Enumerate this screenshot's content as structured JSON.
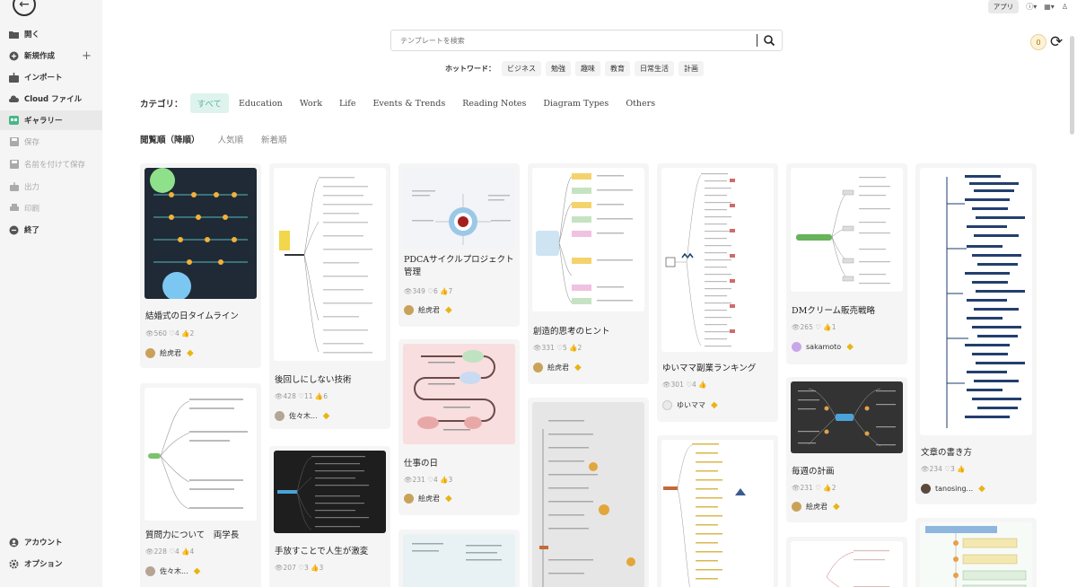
{
  "sidebar": {
    "items": [
      {
        "label": "開く",
        "icon": "folder-icon",
        "state": "normal"
      },
      {
        "label": "新規作成",
        "icon": "plus-circle-icon",
        "state": "normal"
      },
      {
        "label": "インポート",
        "icon": "import-icon",
        "state": "normal"
      },
      {
        "label": "Cloud ファイル",
        "icon": "cloud-icon",
        "state": "normal"
      },
      {
        "label": "ギャラリー",
        "icon": "gallery-icon",
        "state": "active"
      },
      {
        "label": "保存",
        "icon": "save-icon",
        "state": "disabled"
      },
      {
        "label": "名前を付けて保存",
        "icon": "save-as-icon",
        "state": "disabled"
      },
      {
        "label": "出力",
        "icon": "export-icon",
        "state": "disabled"
      },
      {
        "label": "印刷",
        "icon": "print-icon",
        "state": "disabled"
      },
      {
        "label": "終了",
        "icon": "exit-icon",
        "state": "normal"
      }
    ],
    "bottom": [
      {
        "label": "アカウント",
        "icon": "account-icon"
      },
      {
        "label": "オプション",
        "icon": "gear-icon"
      }
    ]
  },
  "topbar": {
    "app_label": "アプリ"
  },
  "coin_count": "0",
  "search": {
    "placeholder": "テンプレートを検索"
  },
  "hot": {
    "label": "ホットワード：",
    "words": [
      "ビジネス",
      "勉強",
      "趣味",
      "教育",
      "日常生活",
      "計画"
    ]
  },
  "categories": {
    "label": "カテゴリ：",
    "items": [
      "すべて",
      "Education",
      "Work",
      "Life",
      "Events & Trends",
      "Reading Notes",
      "Diagram Types",
      "Others"
    ],
    "active": "すべて"
  },
  "sorts": {
    "items": [
      "閲覧順（降順）",
      "人気順",
      "新着順"
    ],
    "active": "閲覧順（降順）"
  },
  "cards": [
    {
      "title": "結婚式の日タイムライン",
      "views": "560",
      "likes": "4",
      "thumbs": "2",
      "author": "絵虎君"
    },
    {
      "title": "質問力について　両学長",
      "views": "228",
      "likes": "4",
      "thumbs": "4",
      "author": "佐々木..."
    },
    {
      "title": "後回しにしない技術",
      "views": "428",
      "likes": "11",
      "thumbs": "6",
      "author": "佐々木..."
    },
    {
      "title": "手放すことで人生が激変",
      "views": "207",
      "likes": "3",
      "thumbs": "3",
      "author": ""
    },
    {
      "title": "PDCAサイクルプロジェクト管理",
      "views": "349",
      "likes": "6",
      "thumbs": "7",
      "author": "絵虎君"
    },
    {
      "title": "仕事の日",
      "views": "231",
      "likes": "4",
      "thumbs": "3",
      "author": "絵虎君"
    },
    {
      "title": "創造的思考のヒント",
      "views": "331",
      "likes": "5",
      "thumbs": "2",
      "author": "絵虎君"
    },
    {
      "title": "ゆいママ副業ランキング",
      "views": "301",
      "likes": "4",
      "thumbs": "",
      "author": "ゆいママ"
    },
    {
      "title": "DMクリーム販売戦略",
      "views": "265",
      "likes": "",
      "thumbs": "1",
      "author": "sakamoto"
    },
    {
      "title": "毎週の計画",
      "views": "231",
      "likes": "",
      "thumbs": "2",
      "author": "絵虎君"
    },
    {
      "title": "文章の書き方",
      "views": "234",
      "likes": "3",
      "thumbs": "",
      "author": "tanosing..."
    }
  ]
}
